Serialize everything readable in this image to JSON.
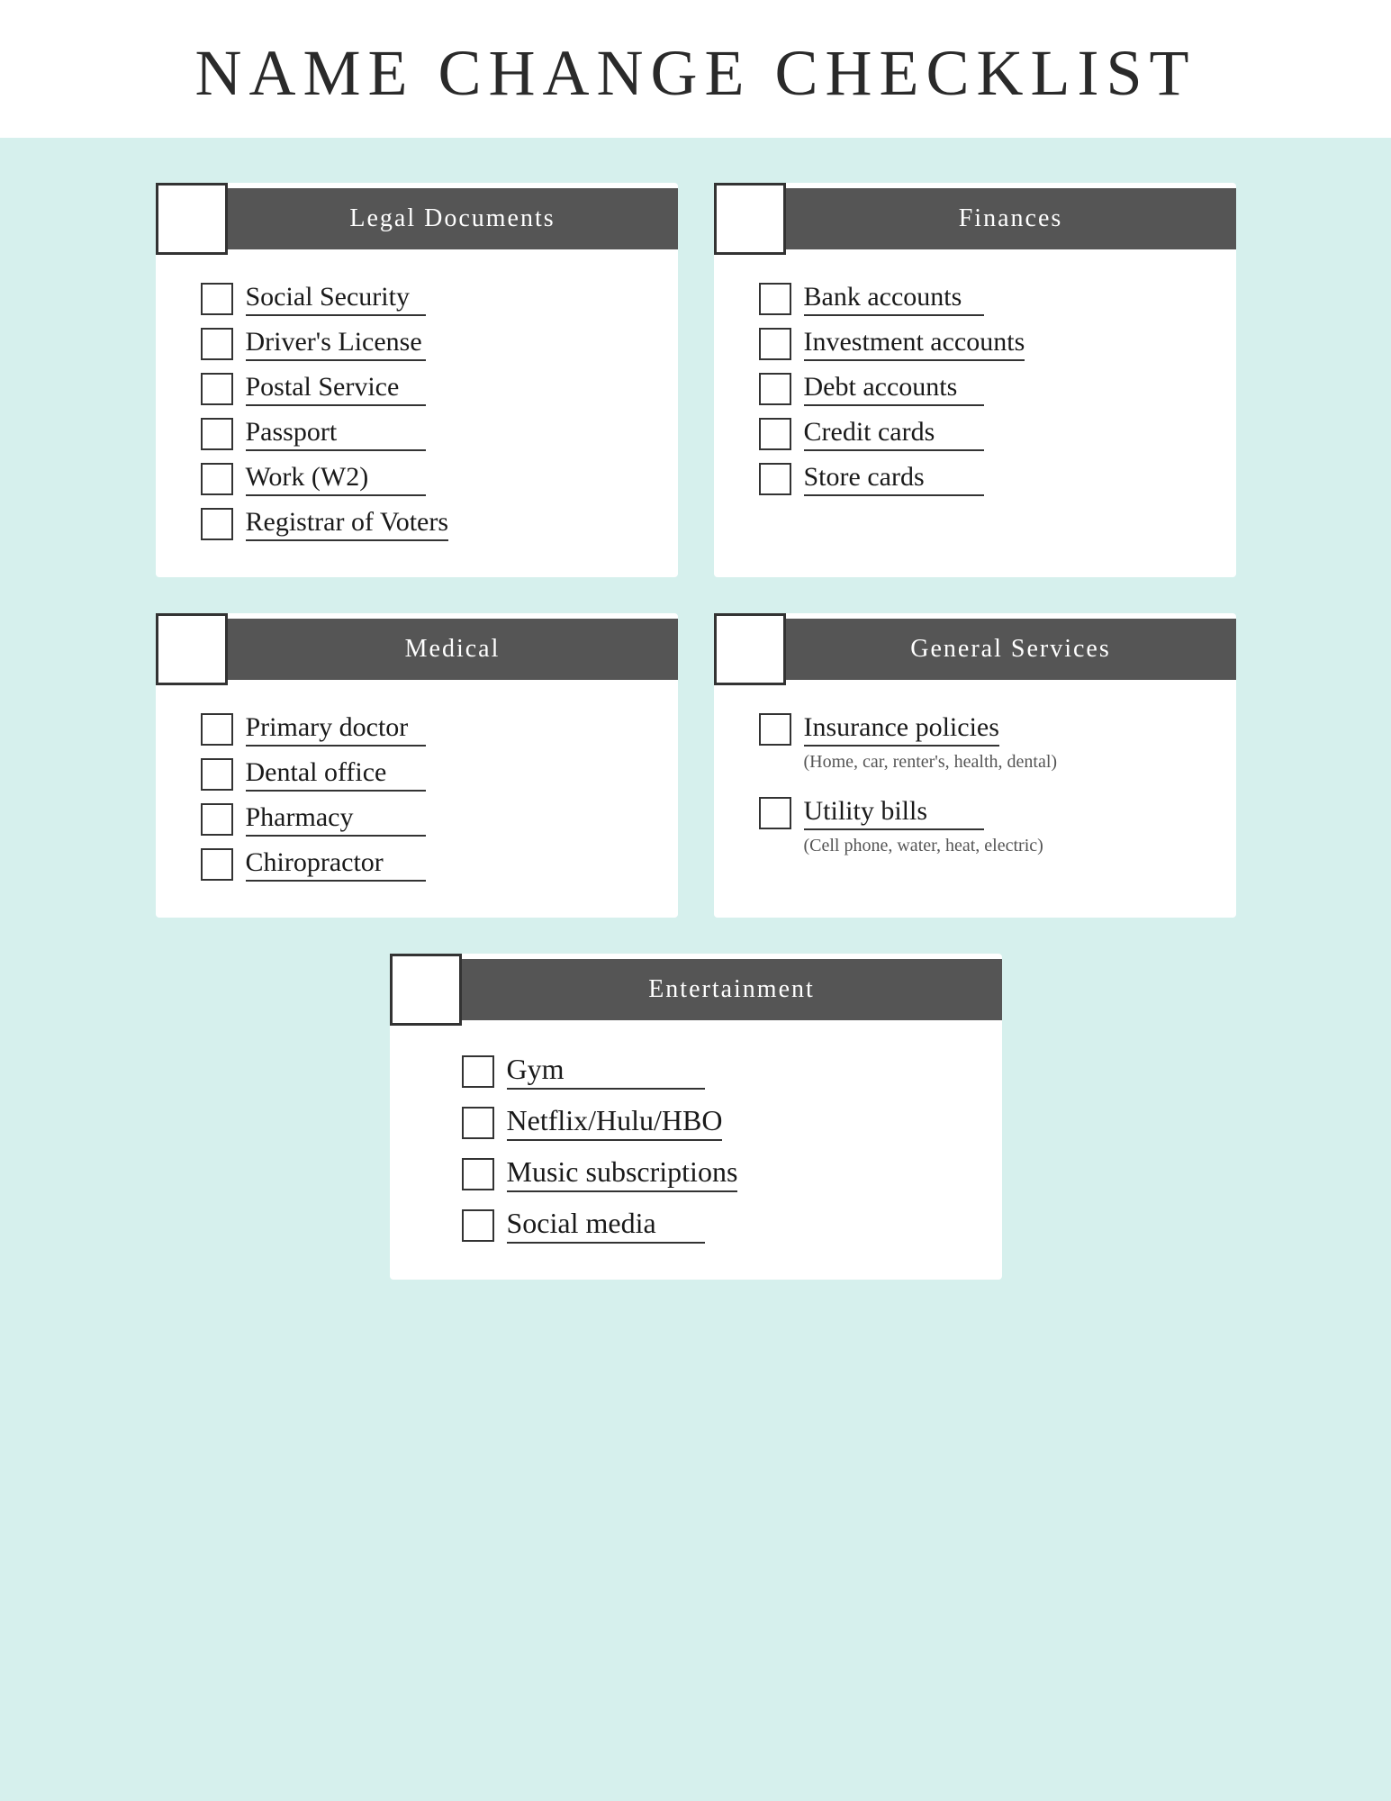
{
  "page": {
    "title": "NAME CHANGE CHECKLIST",
    "background_color": "#d6f0ed",
    "header_bg": "#ffffff"
  },
  "sections": {
    "legal": {
      "title": "Legal Documents",
      "items": [
        "Social Security",
        "Driver's License",
        "Postal Service",
        "Passport",
        "Work (W2)",
        "Registrar of Voters"
      ]
    },
    "finances": {
      "title": "Finances",
      "items": [
        "Bank accounts",
        "Investment accounts",
        "Debt accounts",
        "Credit cards",
        "Store cards"
      ]
    },
    "medical": {
      "title": "Medical",
      "items": [
        "Primary doctor",
        "Dental office",
        "Pharmacy",
        "Chiropractor"
      ]
    },
    "general": {
      "title": "General Services",
      "items": [
        {
          "label": "Insurance policies",
          "sub": "(Home, car, renter's, health, dental)"
        },
        {
          "label": "Utility bills",
          "sub": "(Cell phone, water, heat, electric)"
        }
      ]
    },
    "entertainment": {
      "title": "Entertainment",
      "items": [
        "Gym",
        "Netflix/Hulu/HBO",
        "Music subscriptions",
        "Social media"
      ]
    }
  }
}
